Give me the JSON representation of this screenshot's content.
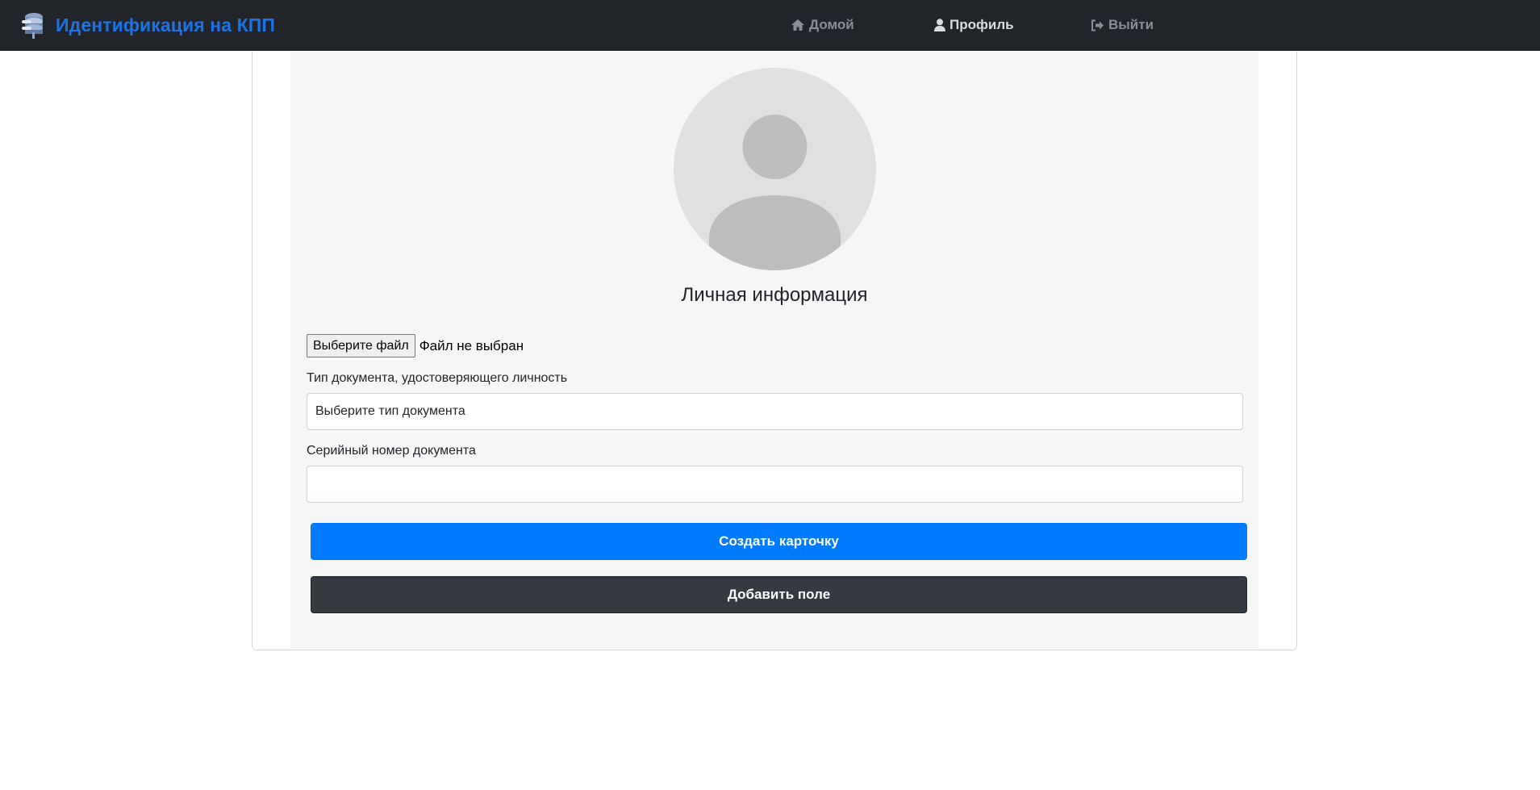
{
  "navbar": {
    "brand": "Идентификация на КПП",
    "links": [
      {
        "label": "Домой",
        "icon": "home-icon",
        "active": false
      },
      {
        "label": "Профиль",
        "icon": "user-icon",
        "active": true
      },
      {
        "label": "Выйти",
        "icon": "sign-out-icon",
        "active": false
      }
    ]
  },
  "form": {
    "title": "Личная информация",
    "avatar_icon": "user-placeholder-icon",
    "file_button": "Выберите файл",
    "file_status": "Файл не выбран",
    "doc_type_label": "Тип документа, удостоверяющего личность",
    "doc_type_value": "Выберите тип документа",
    "serial_label": "Серийный номер документа",
    "serial_value": "",
    "create_button": "Создать карточку",
    "add_field_button": "Добавить поле"
  },
  "colors": {
    "navbar_bg": "#212529",
    "brand": "#1a73e8",
    "primary": "#007bff",
    "dark": "#343a40",
    "panel_bg": "#f6f6f6"
  }
}
